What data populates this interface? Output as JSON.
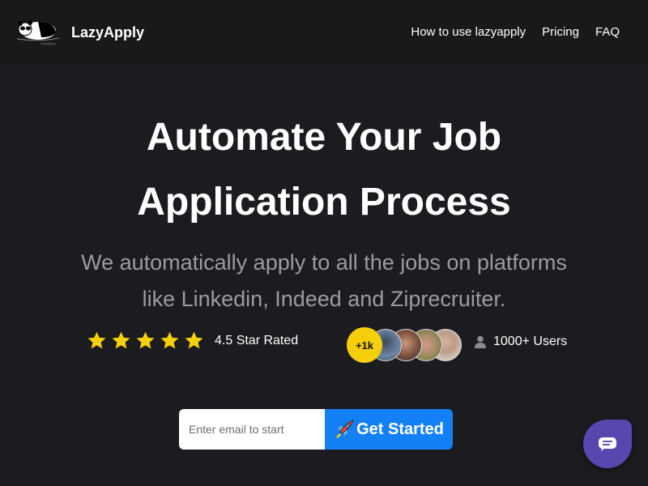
{
  "navbar": {
    "brand": "LazyApply",
    "logo_icon": "panda-logo-icon",
    "links": [
      {
        "label": "How to use lazyapply"
      },
      {
        "label": "Pricing"
      },
      {
        "label": "FAQ"
      }
    ]
  },
  "hero": {
    "title_line1": "Automate Your Job",
    "title_line2": "Application Process",
    "subtitle_line1": "We automatically apply to all the jobs on platforms",
    "subtitle_line2": "like Linkedin, Indeed and Ziprecruiter."
  },
  "rating": {
    "stars": 5,
    "star_color": "#f6cf0b",
    "label": "4.5 Star Rated"
  },
  "users": {
    "badge": "+1k",
    "avatar_count": 4,
    "icon": "user-icon",
    "label": "1000+ Users"
  },
  "signup": {
    "placeholder": "Enter email to start",
    "value": "",
    "button_label": "Get Started",
    "button_icon": "rocket-icon",
    "button_color": "#1380f6"
  },
  "chat_widget": {
    "icon": "chat-icon",
    "color": "#5947b0"
  }
}
